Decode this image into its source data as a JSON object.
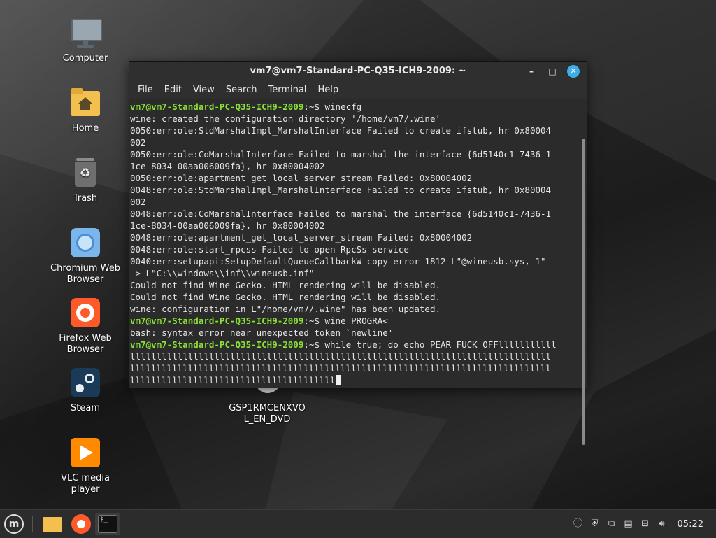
{
  "desktop": {
    "icons": [
      {
        "label": "Computer"
      },
      {
        "label": "Home"
      },
      {
        "label": "Trash"
      },
      {
        "label": "Chromium Web Browser"
      },
      {
        "label": "Firefox Web Browser"
      },
      {
        "label": "Steam"
      },
      {
        "label": "VLC media player"
      },
      {
        "label": "GSP1RMCENXVOL_EN_DVD"
      }
    ]
  },
  "window": {
    "title": "vm7@vm7-Standard-PC-Q35-ICH9-2009: ~",
    "controls": {
      "minimize": "–",
      "maximize": "□",
      "close": "✕"
    },
    "menu": [
      "File",
      "Edit",
      "View",
      "Search",
      "Terminal",
      "Help"
    ]
  },
  "terminal": {
    "prompt_user": "vm7@vm7-Standard-PC-Q35-ICH9-2009",
    "prompt_suffix": ":~$ ",
    "cmd1": "winecfg",
    "out1": [
      "wine: created the configuration directory '/home/vm7/.wine'",
      "0050:err:ole:StdMarshalImpl_MarshalInterface Failed to create ifstub, hr 0x80004",
      "002",
      "0050:err:ole:CoMarshalInterface Failed to marshal the interface {6d5140c1-7436-1",
      "1ce-8034-00aa006009fa}, hr 0x80004002",
      "0050:err:ole:apartment_get_local_server_stream Failed: 0x80004002",
      "0048:err:ole:StdMarshalImpl_MarshalInterface Failed to create ifstub, hr 0x80004",
      "002",
      "0048:err:ole:CoMarshalInterface Failed to marshal the interface {6d5140c1-7436-1",
      "1ce-8034-00aa006009fa}, hr 0x80004002",
      "0048:err:ole:apartment_get_local_server_stream Failed: 0x80004002",
      "0048:err:ole:start_rpcss Failed to open RpcSs service",
      "0040:err:setupapi:SetupDefaultQueueCallbackW copy error 1812 L\"@wineusb.sys,-1\"",
      "-> L\"C:\\\\windows\\\\inf\\\\wineusb.inf\"",
      "Could not find Wine Gecko. HTML rendering will be disabled.",
      "Could not find Wine Gecko. HTML rendering will be disabled.",
      "wine: configuration in L\"/home/vm7/.wine\" has been updated."
    ],
    "cmd2": "wine PROGRA<",
    "out2": "bash: syntax error near unexpected token `newline'",
    "cmd3": "while true; do echo PEAR FUCK OFFlllllllllll",
    "cont": [
      "llllllllllllllllllllllllllllllllllllllllllllllllllllllllllllllllllllllllllllllll",
      "llllllllllllllllllllllllllllllllllllllllllllllllllllllllllllllllllllllllllllllll",
      "lllllllllllllllllllllllllllllllllllllll"
    ]
  },
  "taskbar": {
    "clock": "05:22"
  },
  "colors": {
    "prompt": "#8ae234",
    "close_button": "#3daee9",
    "firefox": "#ff5a2a",
    "vlc": "#ff8a00"
  }
}
